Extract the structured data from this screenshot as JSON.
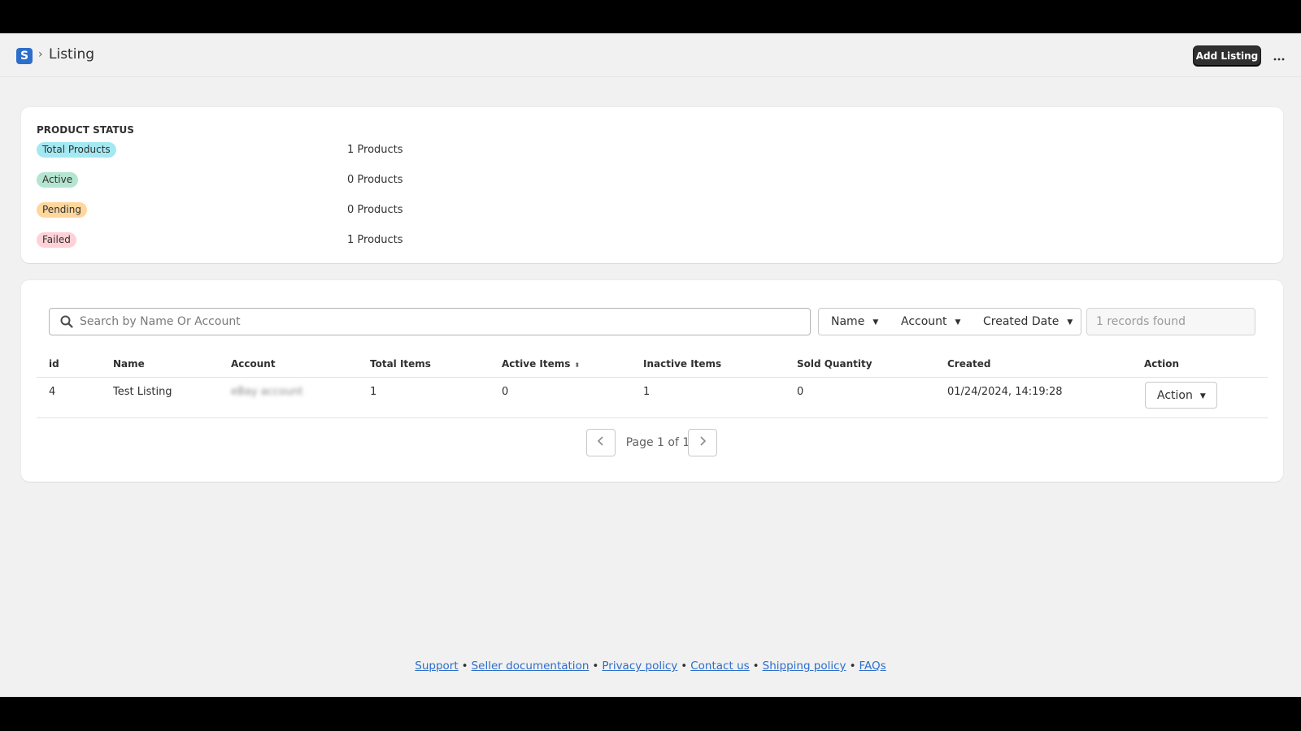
{
  "header": {
    "logo_letter": "S",
    "breadcrumb_sep": "›",
    "title": "Listing",
    "add_button": "Add Listing",
    "more_label": "•••"
  },
  "status": {
    "title": "PRODUCT STATUS",
    "items": [
      {
        "label": "Total Products",
        "count": "1 Products",
        "color": "#a4e8f2"
      },
      {
        "label": "Active",
        "count": "0 Products",
        "color": "#b4e5d0"
      },
      {
        "label": "Pending",
        "count": "0 Products",
        "color": "#ffd79d"
      },
      {
        "label": "Failed",
        "count": "1 Products",
        "color": "#fed1d7"
      }
    ]
  },
  "filters": {
    "search_placeholder": "Search by Name Or Account",
    "name": "Name",
    "account": "Account",
    "created_date": "Created Date",
    "caret": "▼",
    "records_found": "1 records found"
  },
  "table": {
    "columns": [
      "id",
      "Name",
      "Account",
      "Total Items",
      "Active Items",
      "Inactive Items",
      "Sold Quantity",
      "Created",
      "Action"
    ],
    "sort_icon": "⬍",
    "rows": [
      {
        "id": "4",
        "name": "Test Listing",
        "account": "eBay account",
        "total_items": "1",
        "active_items": "0",
        "inactive_items": "1",
        "sold_quantity": "0",
        "created": "01/24/2024, 14:19:28",
        "action": "Action"
      }
    ]
  },
  "pagination": {
    "label": "Page 1 of 1",
    "prev": "‹",
    "next": "›"
  },
  "footer": {
    "links": [
      "Support",
      "Seller documentation",
      "Privacy policy",
      "Contact us",
      "Shipping policy",
      "FAQs"
    ],
    "separator": "•"
  }
}
